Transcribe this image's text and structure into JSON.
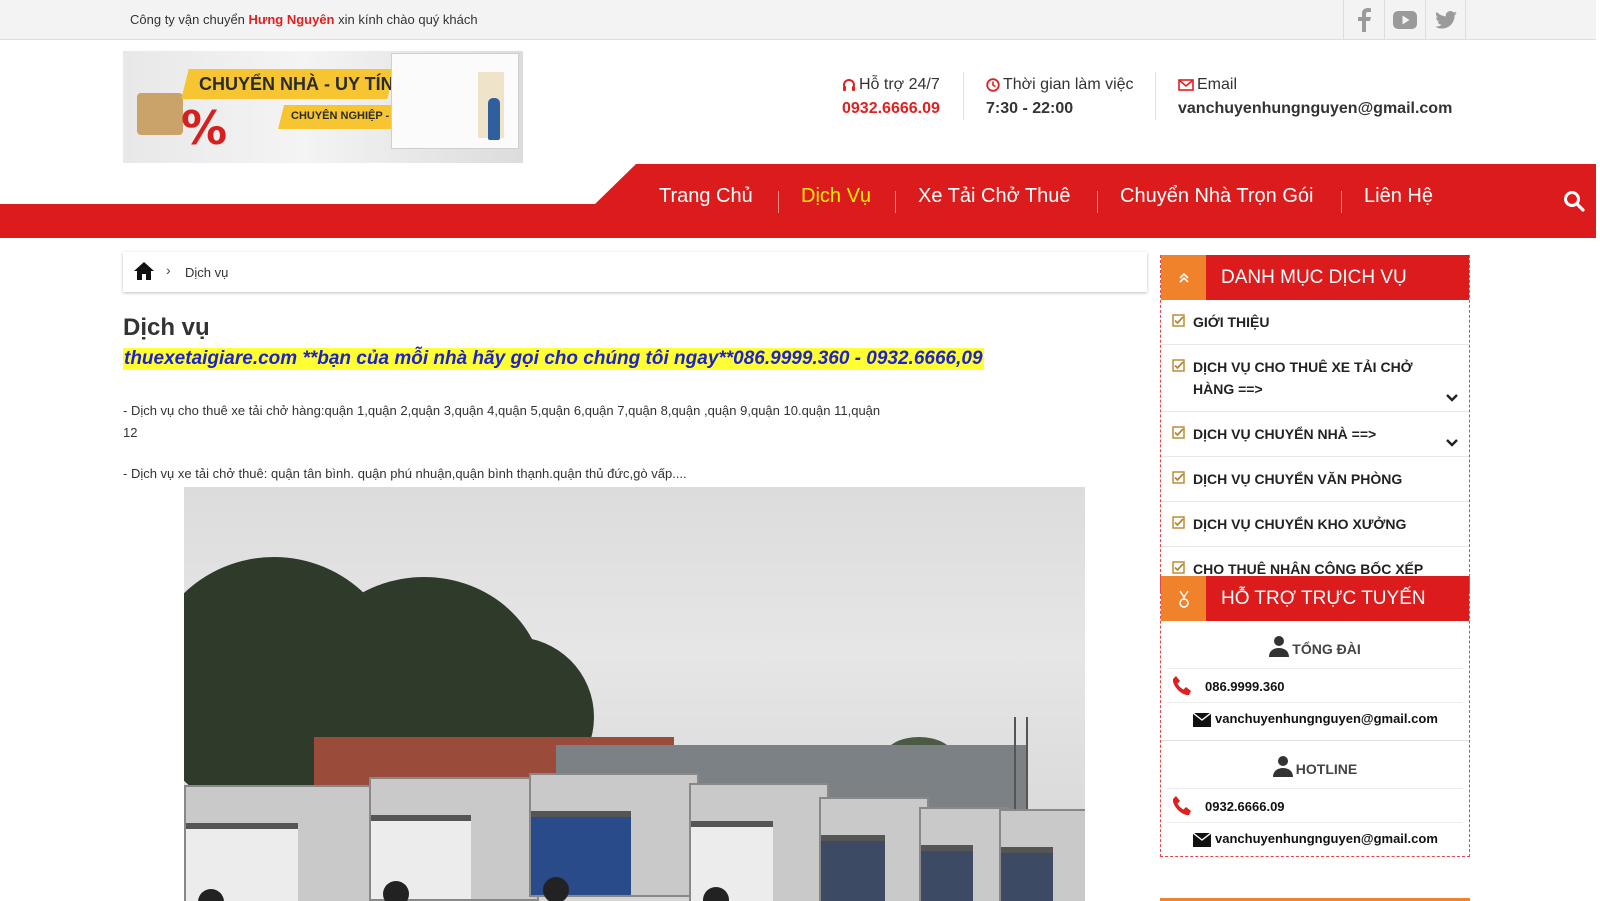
{
  "topbar": {
    "greeting_prefix": "Công ty vận chuyển",
    "greeting_brand": "Hưng Nguyên",
    "greeting_suffix": "xin kính chào quý khách",
    "social_icons": [
      "facebook-icon",
      "youtube-icon",
      "twitter-icon"
    ]
  },
  "logo": {
    "line1": "CHUYỂN NHÀ - UY TÍN",
    "line2": "CHUYÊN NGHIỆP - SIÊU TIẾT KIỆM",
    "percent": "%"
  },
  "header": {
    "support_label": "Hỗ trợ 24/7",
    "support_value": "0932.6666.09",
    "hours_label": "Thời gian làm việc",
    "hours_value": "7:30 - 22:00",
    "email_label": "Email",
    "email_value": "vanchuyenhungnguyen@gmail.com"
  },
  "nav": {
    "items": [
      "Trang Chủ",
      "Dịch Vụ",
      "Xe Tải Chở Thuê",
      "Chuyển Nhà Trọn Gói",
      "Liên Hệ"
    ],
    "active_index": 1
  },
  "breadcrumb": {
    "current": "Dịch vụ"
  },
  "main": {
    "title": "Dịch vụ",
    "highlight": "thuexetaigiare.com **bạn của mỗi nhà hãy gọi cho chúng tôi ngay**086.9999.360 - 0932.6666,09",
    "paragraph1": "- Dịch vụ cho thuê xe tải chở hàng:quận 1,quận 2,quận 3,quận 4,quận 5,quận 6,quận 7,quận 8,quận ,quận 9,quận 10.quận 11,quận 12",
    "paragraph2": "- Dịch vụ xe tải chở thuê: quận tân bình. quận phú nhuận,quận bình thạnh.quận thủ đức,gò vấp...."
  },
  "sidebar": {
    "services_title": "DANH MỤC DỊCH VỤ",
    "services": [
      {
        "label": "GIỚI THIỆU",
        "has_dropdown": false
      },
      {
        "label": "DỊCH VỤ CHO THUÊ XE TẢI CHỞ HÀNG ==>",
        "has_dropdown": true
      },
      {
        "label": "DỊCH VỤ CHUYỂN NHÀ ==>",
        "has_dropdown": true
      },
      {
        "label": "DỊCH VỤ CHUYỂN VĂN PHÒNG",
        "has_dropdown": false
      },
      {
        "label": "DỊCH VỤ CHUYỂN KHO XƯỞNG",
        "has_dropdown": false
      },
      {
        "label": "CHO THUÊ NHÂN CÔNG BỐC XẾP",
        "has_dropdown": false
      }
    ],
    "support_title": "HỖ TRỢ TRỰC TUYẾN",
    "support_groups": [
      {
        "role": "TỔNG ĐÀI",
        "phone": "086.9999.360",
        "email": "vanchuyenhungnguyen@gmail.com"
      },
      {
        "role": "HOTLINE",
        "phone": "0932.6666.09",
        "email": "vanchuyenhungnguyen@gmail.com"
      }
    ]
  },
  "colors": {
    "brand_red": "#dc1c1c",
    "accent_orange": "#f0822b",
    "nav_active": "#ffee00",
    "highlight_bg": "#ffff33",
    "highlight_text": "#1e23c9"
  }
}
